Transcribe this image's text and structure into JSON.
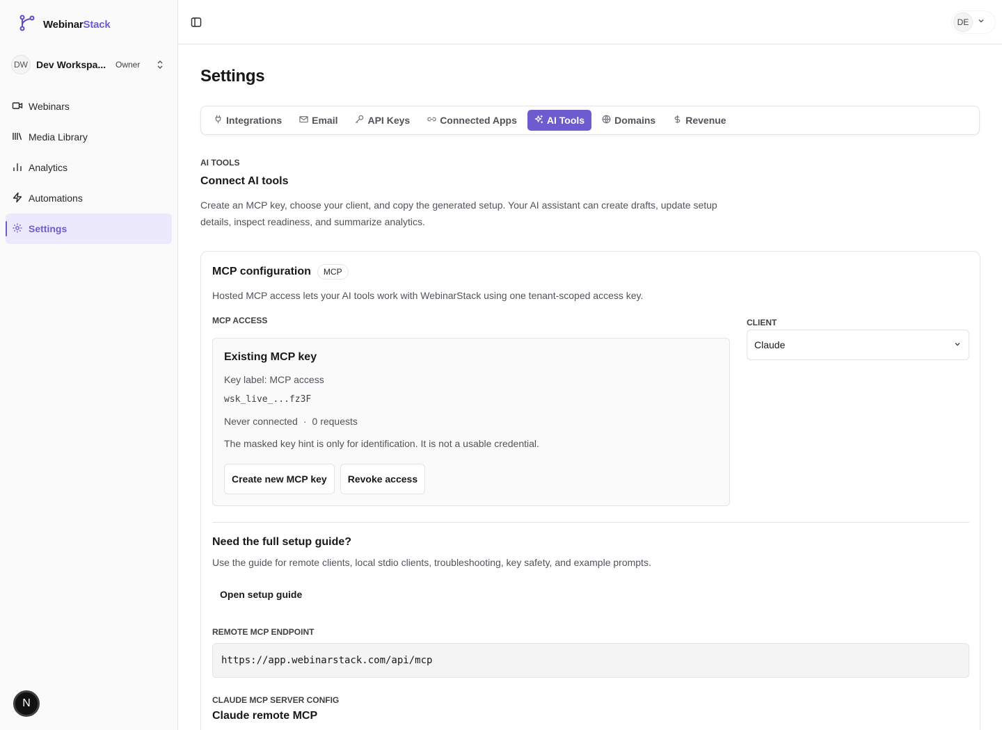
{
  "brand": {
    "name_part1": "Webinar",
    "name_part2": "Stack",
    "accent_color": "#6d5bd0"
  },
  "workspace": {
    "initials": "DW",
    "name": "Dev Workspa...",
    "role": "Owner"
  },
  "sidebar": {
    "items": [
      {
        "label": "Webinars",
        "icon": "video-icon",
        "active": false
      },
      {
        "label": "Media Library",
        "icon": "library-icon",
        "active": false
      },
      {
        "label": "Analytics",
        "icon": "bar-chart-icon",
        "active": false
      },
      {
        "label": "Automations",
        "icon": "lightning-icon",
        "active": false
      },
      {
        "label": "Settings",
        "icon": "gear-icon",
        "active": true
      }
    ]
  },
  "floating_badge": {
    "letter": "N"
  },
  "user": {
    "initials": "DE"
  },
  "page": {
    "title": "Settings"
  },
  "tabs": [
    {
      "label": "Integrations",
      "icon": "plug-icon",
      "active": false
    },
    {
      "label": "Email",
      "icon": "mail-icon",
      "active": false
    },
    {
      "label": "API Keys",
      "icon": "key-icon",
      "active": false
    },
    {
      "label": "Connected Apps",
      "icon": "link-icon",
      "active": false
    },
    {
      "label": "AI Tools",
      "icon": "sparkles-icon",
      "active": true
    },
    {
      "label": "Domains",
      "icon": "globe-icon",
      "active": false
    },
    {
      "label": "Revenue",
      "icon": "dollar-icon",
      "active": false
    }
  ],
  "section": {
    "eyebrow": "AI TOOLS",
    "title": "Connect AI tools",
    "description": "Create an MCP key, choose your client, and copy the generated setup. Your AI assistant can create drafts, update setup details, inspect readiness, and summarize analytics."
  },
  "mcp_card": {
    "title": "MCP configuration",
    "badge": "MCP",
    "description": "Hosted MCP access lets your AI tools work with WebinarStack using one tenant-scoped access key.",
    "access_label": "MCP ACCESS",
    "client_label": "CLIENT",
    "client_value": "Claude",
    "key": {
      "title": "Existing MCP key",
      "label_line": "Key label: MCP access",
      "masked": "wsk_live_...fz3F",
      "status": "Never connected",
      "separator": "·",
      "requests": "0 requests",
      "note": "The masked key hint is only for identification. It is not a usable credential.",
      "create_button": "Create new MCP key",
      "revoke_button": "Revoke access"
    },
    "guide": {
      "title": "Need the full setup guide?",
      "description": "Use the guide for remote clients, local stdio clients, troubleshooting, key safety, and example prompts.",
      "link": "Open setup guide"
    },
    "endpoint_label": "REMOTE MCP ENDPOINT",
    "endpoint_value": "https://app.webinarstack.com/api/mcp",
    "config_label": "CLAUDE MCP SERVER CONFIG",
    "config_title": "Claude remote MCP"
  }
}
